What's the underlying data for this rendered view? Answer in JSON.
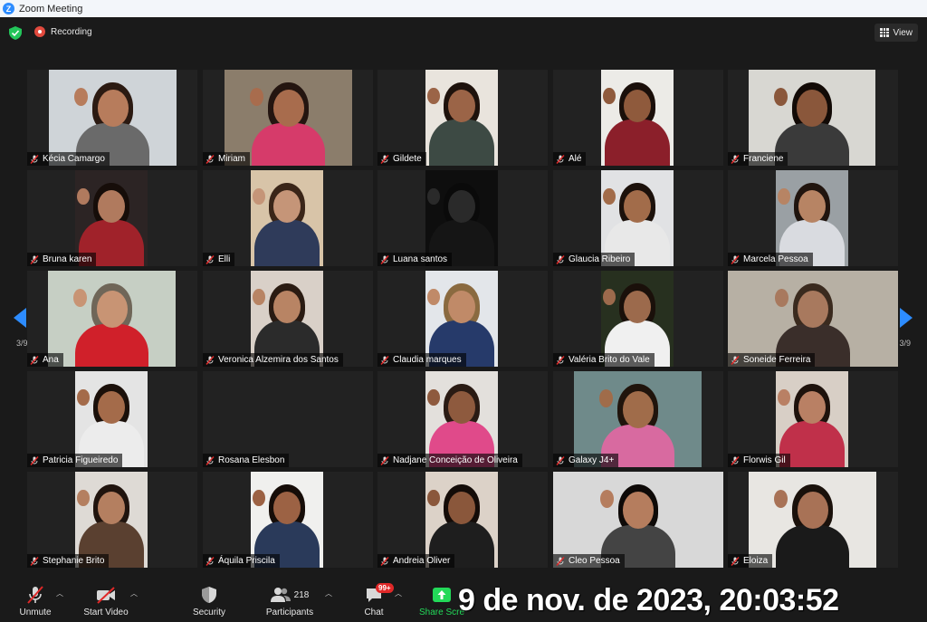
{
  "window": {
    "title": "Zoom Meeting"
  },
  "topbar": {
    "recording_label": "Recording",
    "view_label": "View"
  },
  "pagination": {
    "left_label": "3/9",
    "right_label": "3/9"
  },
  "participants": [
    {
      "name": "Kécia Camargo",
      "bg": "#cfd4d8",
      "skin": "#b77c5c",
      "hair": "#2b1a12",
      "shirt": "#6a6a6a"
    },
    {
      "name": "Miriam",
      "bg": "#8b7d6b",
      "skin": "#a86c4d",
      "hair": "#241510",
      "shirt": "#d63b6a"
    },
    {
      "name": "Gildete",
      "bg": "#e9e4dd",
      "skin": "#9b6447",
      "hair": "#1e120c",
      "shirt": "#3d4a44"
    },
    {
      "name": "Alé",
      "bg": "#ecebe7",
      "skin": "#8f5a3c",
      "hair": "#1a0f0a",
      "shirt": "#8b1f2a"
    },
    {
      "name": "Franciene",
      "bg": "#d8d7d2",
      "skin": "#8a573b",
      "hair": "#120a06",
      "shirt": "#3a3a3a"
    },
    {
      "name": "Bruna karen",
      "bg": "#2c2424",
      "skin": "#b07a5e",
      "hair": "#160d09",
      "shirt": "#a0222a"
    },
    {
      "name": "Elli",
      "bg": "#d8c4a8",
      "skin": "#c59578",
      "hair": "#3a2518",
      "shirt": "#2f3b5a"
    },
    {
      "name": "Luana santos",
      "bg": "#0e0e0e",
      "skin": "#2a2a2a",
      "hair": "#0a0a0a",
      "shirt": "#151515"
    },
    {
      "name": "Glaucia Ribeiro",
      "bg": "#e1e2e4",
      "skin": "#a26c4a",
      "hair": "#1c110b",
      "shirt": "#e8e8e8"
    },
    {
      "name": "Marcela Pessoa",
      "bg": "#9aa0a4",
      "skin": "#b78464",
      "hair": "#20140e",
      "shirt": "#d9dbe0"
    },
    {
      "name": "Ana",
      "bg": "#c6cfc4",
      "skin": "#c89474",
      "hair": "#6f6658",
      "shirt": "#d0202a"
    },
    {
      "name": "Veronica Alzemira dos Santos",
      "bg": "#d9d0c8",
      "skin": "#b88464",
      "hair": "#2a1b12",
      "shirt": "#2b2b2b"
    },
    {
      "name": "Claudia marques",
      "bg": "#e3e6ea",
      "skin": "#c08a68",
      "hair": "#8a6a40",
      "shirt": "#263a6a"
    },
    {
      "name": "Valéria Brito do Vale",
      "bg": "#27301f",
      "skin": "#9c6a4c",
      "hair": "#1a100a",
      "shirt": "#f0f0f0"
    },
    {
      "name": "Soneide Ferreira",
      "bg": "#b7b0a4",
      "skin": "#a8795e",
      "hair": "#3a2a1e",
      "shirt": "#3a2e2a"
    },
    {
      "name": "Patricia Figueiredo",
      "bg": "#e4e4e4",
      "skin": "#a46b4a",
      "hair": "#1b100a",
      "shirt": "#ececec"
    },
    {
      "name": "Rosana Elesbon",
      "bg": "#222222",
      "skin": "#222222",
      "hair": "#222222",
      "shirt": "#222222"
    },
    {
      "name": "Nadjane Conceição de Oliveira",
      "bg": "#e3e0dc",
      "skin": "#8e5a3e",
      "hair": "#2a1b14",
      "shirt": "#e04a8a"
    },
    {
      "name": "Galaxy J4+",
      "bg": "#6f8a8a",
      "skin": "#a06c4a",
      "hair": "#20140c",
      "shirt": "#d86aa0"
    },
    {
      "name": "Florwis Gil",
      "bg": "#d8cfc6",
      "skin": "#b98064",
      "hair": "#1e120c",
      "shirt": "#c0304a"
    },
    {
      "name": "Stephanie Brito",
      "bg": "#dedad5",
      "skin": "#b47f60",
      "hair": "#20140e",
      "shirt": "#5a4030"
    },
    {
      "name": "Áquila Priscila",
      "bg": "#f0f0ee",
      "skin": "#9c6244",
      "hair": "#160d08",
      "shirt": "#2a3a5a"
    },
    {
      "name": "Andreia Oliver",
      "bg": "#dcd2c8",
      "skin": "#8a573b",
      "hair": "#140c08",
      "shirt": "#1e1e1e"
    },
    {
      "name": "Cleo Pessoa",
      "bg": "#d8d8d8",
      "skin": "#b57d5e",
      "hair": "#0e0a08",
      "shirt": "#444444"
    },
    {
      "name": "Eloiza",
      "bg": "#e8e6e2",
      "skin": "#a87256",
      "hair": "#1a110b",
      "shirt": "#1a1a1a"
    }
  ],
  "toolbar": {
    "unmute": "Unmute",
    "start_video": "Start Video",
    "security": "Security",
    "participants": "Participants",
    "participants_count": "218",
    "chat": "Chat",
    "chat_badge": "99+",
    "share_screen": "Share Scre"
  },
  "overlay": {
    "timestamp": "9 de nov. de 2023, 20:03:52"
  },
  "colors": {
    "accent": "#2d8cff",
    "share_green": "#23d959",
    "record_red": "#e24a3e",
    "muted_red": "#e02828"
  }
}
